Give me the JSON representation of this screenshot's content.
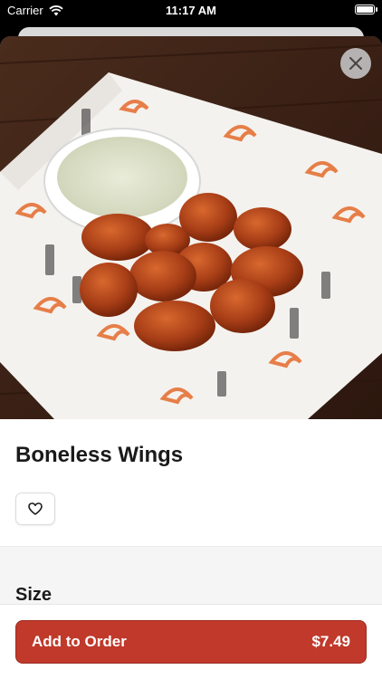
{
  "status_bar": {
    "carrier": "Carrier",
    "time": "11:17 AM"
  },
  "item": {
    "name": "Boneless Wings",
    "section_title": "Size"
  },
  "footer": {
    "button_label": "Add to Order",
    "price": "$7.49"
  },
  "colors": {
    "accent": "#c0392b"
  },
  "icons": {
    "close": "close-icon",
    "favorite": "heart-icon",
    "wifi": "wifi-icon",
    "battery": "battery-icon"
  }
}
